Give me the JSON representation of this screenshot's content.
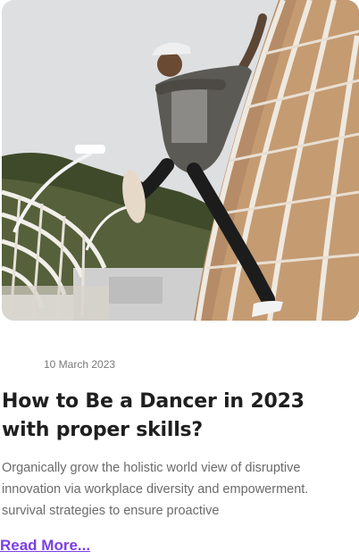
{
  "post": {
    "image_alt": "Man in a white cap jumping through a perforated metal tunnel",
    "date": "10 March 2023",
    "title": "How to Be a Dancer in 2023 with proper skills?",
    "excerpt": "Organically grow the holistic world view of disruptive innovation via workplace diversity and empowerment. survival strategies to ensure proactive",
    "read_more": "Read More..."
  },
  "colors": {
    "accent": "#7b3fe4",
    "title": "#1f1f1f",
    "muted": "#6b6b6b"
  }
}
